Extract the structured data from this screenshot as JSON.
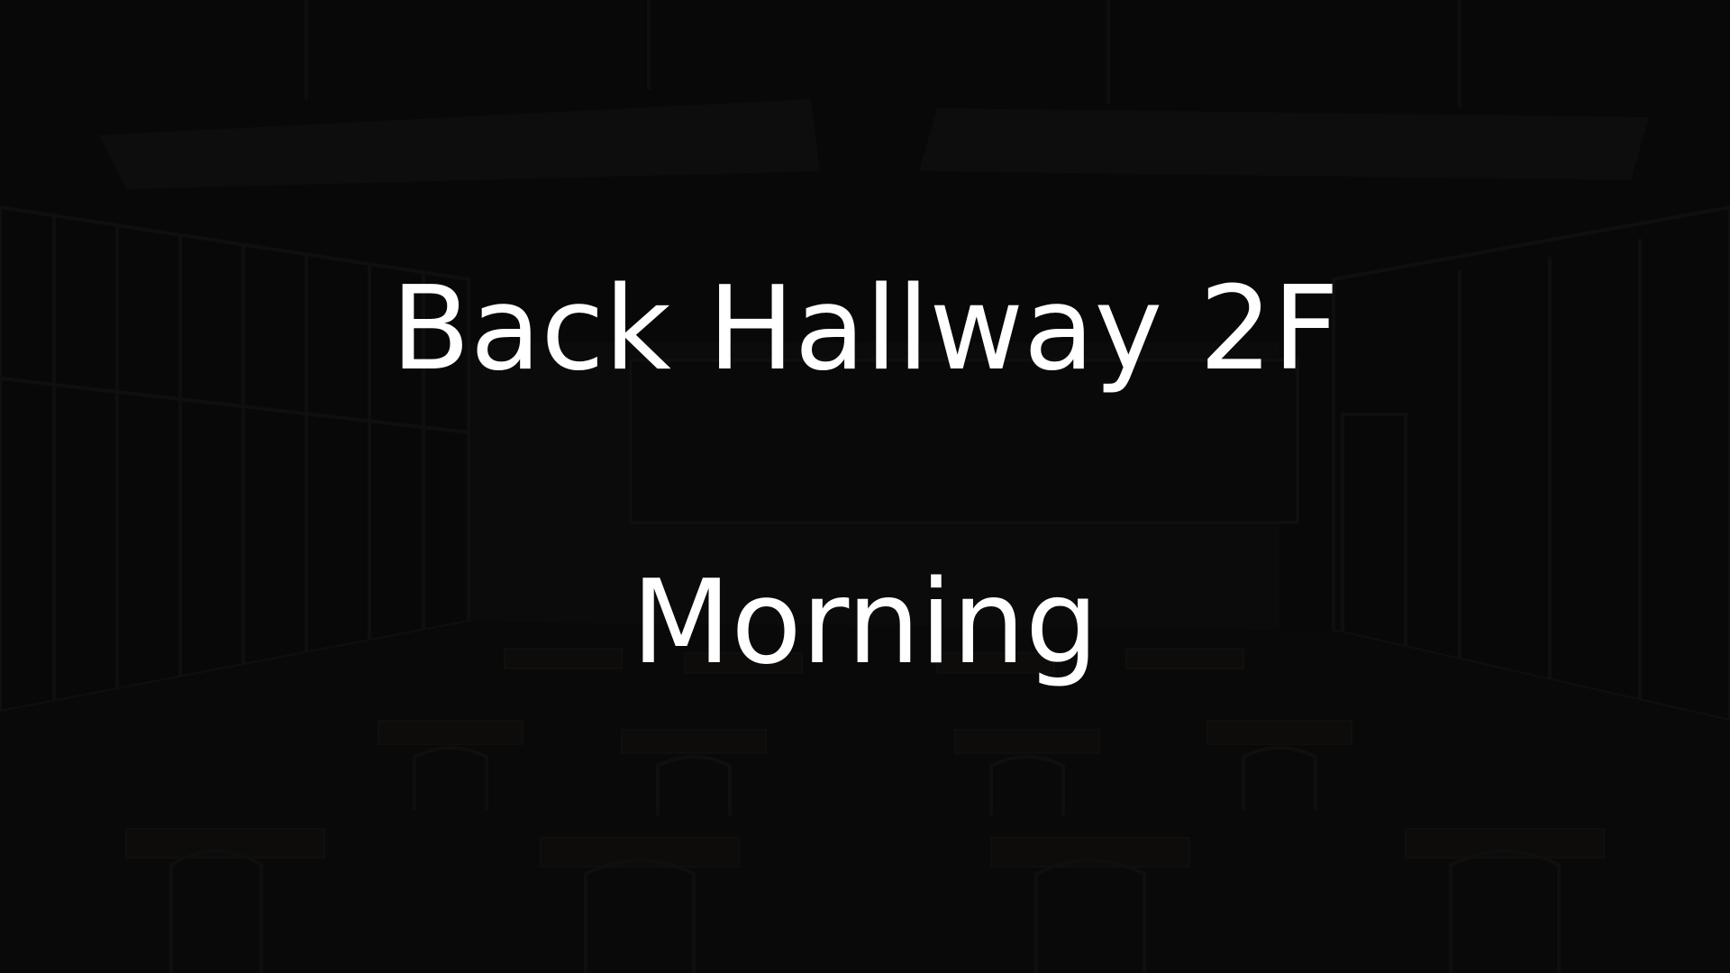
{
  "scene": {
    "background": "dark-classroom-hallway",
    "colors": {
      "base": "#0c0c0c",
      "text": "#ffffff"
    }
  },
  "transition_card": {
    "location": "Back Hallway 2F",
    "time_of_day": "Morning"
  }
}
